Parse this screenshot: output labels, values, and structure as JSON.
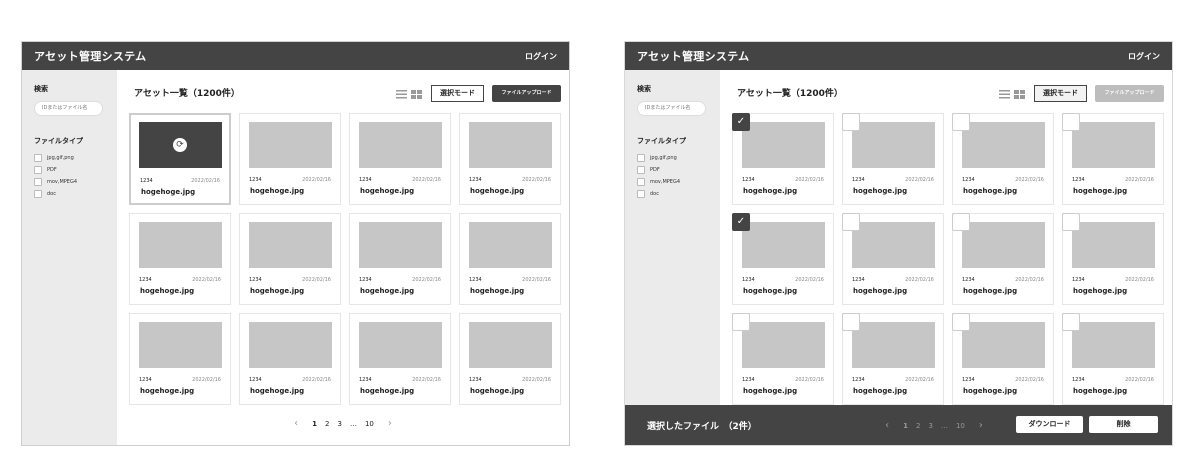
{
  "app": {
    "title": "アセット管理システム",
    "login": "ログイン"
  },
  "sidebar": {
    "search_label": "検索",
    "search_placeholder": "IDまたはファイル名",
    "filetype_label": "ファイルタイプ",
    "filetypes": [
      "jpg,gif,png",
      "PDF",
      "mov,MPEG4",
      "doc"
    ]
  },
  "main": {
    "list_title": "アセット一覧（1200件）",
    "select_mode": "選択モード",
    "upload": "ファイルアップロード"
  },
  "card": {
    "id": "1234",
    "date": "2022/02/16",
    "name": "hogehoge.jpg",
    "sync_icon": "⟳"
  },
  "pager": {
    "prev": "‹",
    "pages": [
      "1",
      "2",
      "3"
    ],
    "ellipsis": "…",
    "last": "10",
    "next": "›"
  },
  "selection": {
    "label": "選択したファイル　（2件）",
    "download": "ダウンロード",
    "delete": "削除",
    "check": "✓"
  }
}
